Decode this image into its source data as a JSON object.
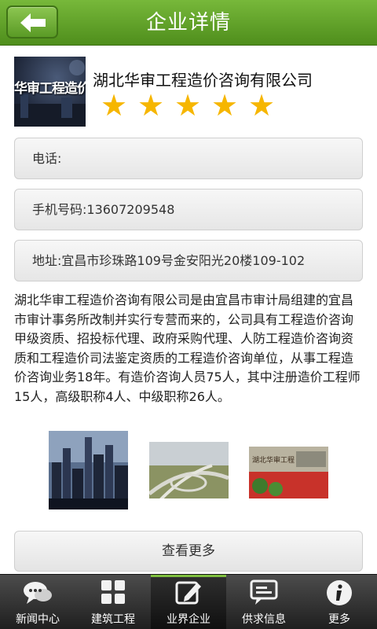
{
  "header": {
    "title": "企业详情",
    "back_icon": "back-arrow-icon"
  },
  "company": {
    "logo_text": "华审工程造价",
    "name": "湖北华审工程造价咨询有限公司",
    "rating": 5,
    "rating_max": 5,
    "star_color": "#f6b600"
  },
  "contact": {
    "phone": "电话:",
    "mobile": "手机号码:13607209548",
    "address": "地址:宜昌市珍珠路109号金安阳光20楼109-102"
  },
  "description": "湖北华审工程造价咨询有限公司是由宜昌市审计局组建的宜昌市审计事务所改制并实行专营而来的，公司具有工程造价咨询甲级资质、招投标代理、政府采购代理、人防工程造价咨询资质和工程造价司法鉴定资质的工程造价咨询单位，从事工程造价咨询业务18年。有造价咨询人员75人，其中注册造价工程师15人，高级职称4人、中级职称26人。",
  "gallery": {
    "photo3_caption": "湖北华审工程"
  },
  "more_button": "查看更多",
  "bottom_nav": {
    "items": [
      {
        "label": "新闻中心",
        "icon": "news-chat-icon"
      },
      {
        "label": "建筑工程",
        "icon": "grid-icon"
      },
      {
        "label": "业界企业",
        "icon": "edit-icon",
        "active": true
      },
      {
        "label": "供求信息",
        "icon": "message-icon"
      },
      {
        "label": "更多",
        "icon": "info-icon"
      }
    ]
  },
  "colors": {
    "header_green": "#5f9f26",
    "active_accent": "#7fbf3f"
  }
}
